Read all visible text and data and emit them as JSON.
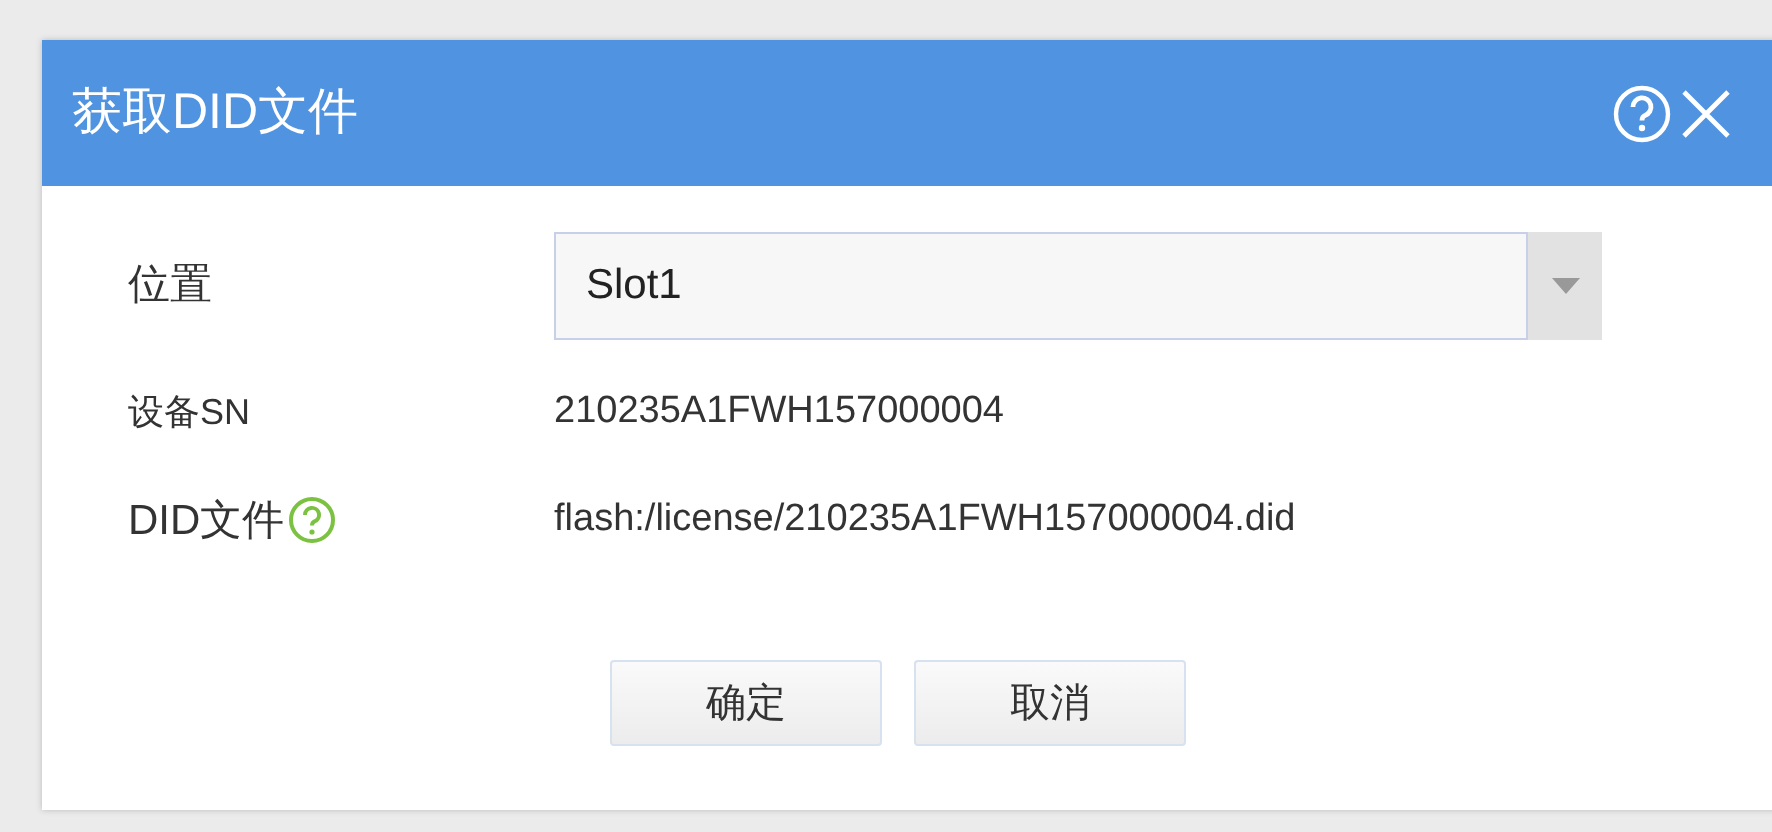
{
  "dialog": {
    "title": "获取DID文件"
  },
  "fields": [
    {
      "kind": "select",
      "label": "位置",
      "value": "Slot1",
      "help": false
    },
    {
      "kind": "text",
      "label": "设备SN",
      "value": "210235A1FWH157000004",
      "help": false
    },
    {
      "kind": "text",
      "label": "DID文件",
      "value": "flash:/license/210235A1FWH157000004.did",
      "help": true
    }
  ],
  "buttons": [
    "确定",
    "取消"
  ]
}
